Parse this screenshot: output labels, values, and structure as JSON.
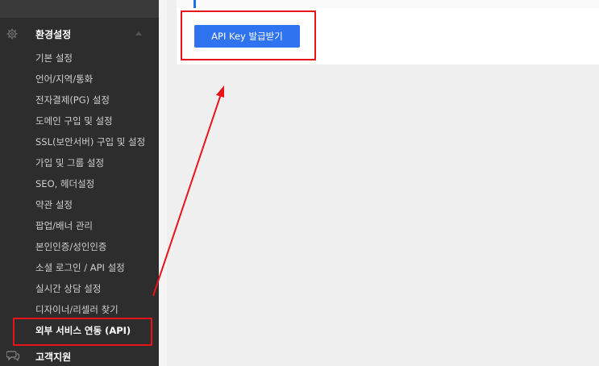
{
  "sidebar": {
    "section_title": "환경설정",
    "items": [
      {
        "label": "기본 설정"
      },
      {
        "label": "언어/지역/통화"
      },
      {
        "label": "전자결제(PG) 설정"
      },
      {
        "label": "도메인 구입 및 설정"
      },
      {
        "label": "SSL(보안서버) 구입 및 설정"
      },
      {
        "label": "가입 및 그룹 설정"
      },
      {
        "label": "SEO, 헤더설정"
      },
      {
        "label": "약관 설정"
      },
      {
        "label": "팝업/배너 관리"
      },
      {
        "label": "본인인증/성인인증"
      },
      {
        "label": "소셜 로그인 / API 설정"
      },
      {
        "label": "실시간 상담 설정"
      },
      {
        "label": "디자이너/리셀러 찾기"
      },
      {
        "label": "외부 서비스 연동 (API)"
      }
    ],
    "active_index": 13,
    "footer_label": "고객지원",
    "icons": {
      "section": "gear-icon",
      "footer": "chat-icon",
      "caret": "caret-up-icon"
    }
  },
  "main": {
    "api_button_label": "API Key 발급받기"
  },
  "colors": {
    "sidebar_bg": "#2d2d2d",
    "button_bg": "#2f73f1",
    "highlight": "#e8141c",
    "accent": "#1a73e8"
  }
}
